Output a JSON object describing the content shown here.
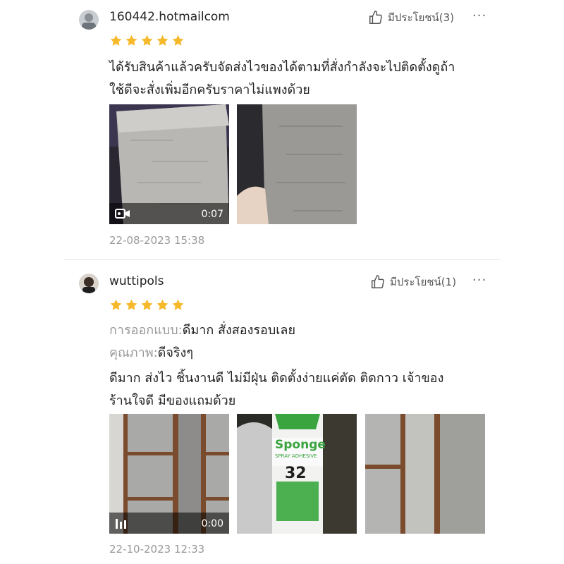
{
  "reviews": [
    {
      "username": "160442.hotmailcom",
      "helpful": "มีประโยชน์(3)",
      "more": "···",
      "rating": 5,
      "body_line1": "ได้รับสินค้าแล้วครับจัดส่งไวของได้ตามที่สั่งกำลังจะไปติดตั้งดูถ้า",
      "body_line2": "ใช้ดีจะสั่งเพิ่มอีกครับราคาไม่แพงด้วย",
      "video_duration": "0:07",
      "date": "22-08-2023 15:38"
    },
    {
      "username": "wuttipols",
      "helpful": "มีประโยชน์(1)",
      "more": "···",
      "rating": 5,
      "design_label": "การออกแบบ:",
      "design_value": "ดีมาก สั่งสองรอบเลย",
      "quality_label": "คุณภาพ:",
      "quality_value": "ดีจริงๆ",
      "body_line1": "ดีมาก ส่งไว ชิ้นงานดี ไม่มีฝุ่น ติดตั้งง่ายแค่ตัด ติดกาว  เจ้าของ",
      "body_line2": "ร้านใจดี มีของแถมด้วย",
      "video_duration": "0:00",
      "can_brand": "Sponge",
      "can_subtitle": "SPRAY ADHESIVE",
      "can_number": "32",
      "date": "22-10-2023 12:33"
    }
  ],
  "colors": {
    "star": "#f6b92b",
    "muted": "#999999",
    "text": "#222222",
    "can_green": "#3aa53f"
  }
}
